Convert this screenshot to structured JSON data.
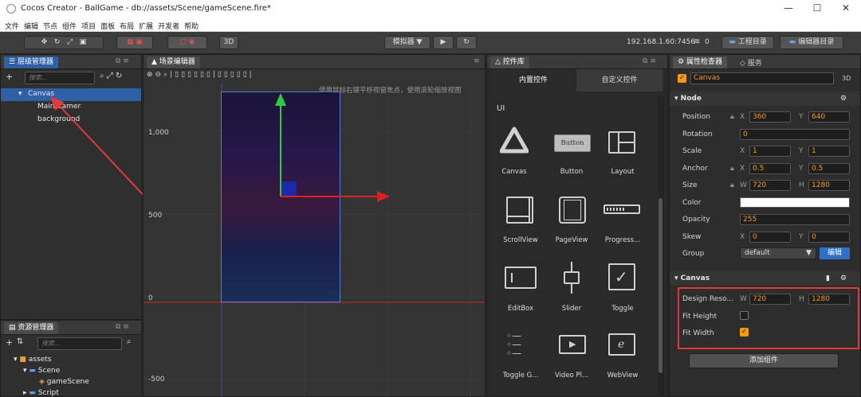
{
  "window": {
    "title": "Cocos Creator - BallGame - db://assets/Scene/gameScene.fire*",
    "minimize": "—",
    "maximize": "☐",
    "close": "✕"
  },
  "menu": [
    "文件",
    "编辑",
    "节点",
    "组件",
    "项目",
    "面板",
    "布局",
    "扩展",
    "开发者",
    "帮助"
  ],
  "toolbar": {
    "simulator": "模拟器 ▼",
    "mode3d": "3D",
    "ip": "192.168.1.60:7456",
    "wifi_count": "0",
    "project_dir": "工程目录",
    "editor_dir": "编辑器目录"
  },
  "hierarchy": {
    "title": "层级管理器",
    "search_placeholder": "搜索...",
    "nodes": [
      "Canvas",
      "Main Camera",
      "background"
    ]
  },
  "scene": {
    "title": "场景编辑器",
    "hint": "使用鼠标右键平移视窗焦点，使用滚轮缩放视图",
    "ruler": [
      "1,000",
      "500",
      "0",
      "-500"
    ]
  },
  "assets": {
    "title": "资源管理器",
    "search_placeholder": "搜索...",
    "items": [
      "assets",
      "Scene",
      "gameScene",
      "Script"
    ]
  },
  "library": {
    "title": "控件库",
    "tab_builtin": "内置控件",
    "tab_custom": "自定义控件",
    "section": "UI",
    "items": [
      "Canvas",
      "Button",
      "Layout",
      "ScrollView",
      "PageView",
      "Progress...",
      "EditBox",
      "Slider",
      "Toggle",
      "Toggle G...",
      "Video Pl...",
      "WebView"
    ],
    "button_preview": "Button"
  },
  "inspector": {
    "title": "属性检查器",
    "service_tab": "服务",
    "node_name": "Canvas",
    "mode": "3D",
    "node_section": "Node",
    "position": {
      "label": "Position",
      "x": "360",
      "y": "640"
    },
    "rotation": {
      "label": "Rotation",
      "value": "0"
    },
    "scale": {
      "label": "Scale",
      "x": "1",
      "y": "1"
    },
    "anchor": {
      "label": "Anchor",
      "x": "0.5",
      "y": "0.5"
    },
    "size": {
      "label": "Size",
      "w": "720",
      "h": "1280"
    },
    "color": {
      "label": "Color",
      "value": "#ffffff"
    },
    "opacity": {
      "label": "Opacity",
      "value": "255"
    },
    "skew": {
      "label": "Skew",
      "x": "0",
      "y": "0"
    },
    "group": {
      "label": "Group",
      "value": "default",
      "edit": "编辑"
    },
    "canvas_section": "Canvas",
    "design_res": {
      "label": "Design Reso...",
      "w": "720",
      "h": "1280"
    },
    "fit_height": {
      "label": "Fit Height",
      "checked": false
    },
    "fit_width": {
      "label": "Fit Width",
      "checked": true
    },
    "add_component": "添加组件",
    "axis": {
      "x": "X",
      "y": "Y",
      "w": "W",
      "h": "H"
    }
  },
  "colors": {
    "accent": "#2f5fa5",
    "highlight_box": "#e03a3a",
    "value_orange": "#f39c12"
  }
}
